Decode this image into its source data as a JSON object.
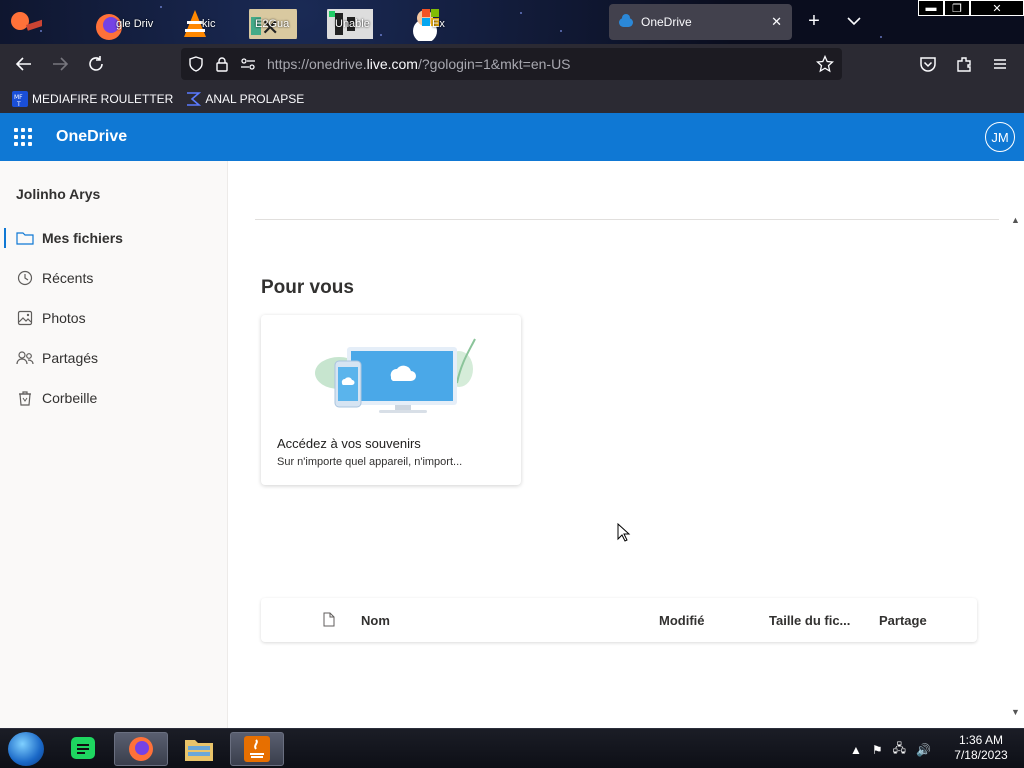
{
  "browser": {
    "desktop_icons": [
      {
        "name": "google-drive",
        "label": "gle Driv"
      },
      {
        "name": "vlc",
        "label": "kic"
      },
      {
        "name": "e2guard",
        "label": "E2Gua"
      },
      {
        "name": "unable",
        "label": "Unable"
      },
      {
        "name": "windows-user",
        "label": "Ex"
      }
    ],
    "active_tab": {
      "title": "OneDrive",
      "close": "✕"
    },
    "new_tab": "+",
    "window_buttons": {
      "min": "▬",
      "max": "❐",
      "close": "✕"
    },
    "url": {
      "prefix": "https://onedrive.",
      "host": "live.com",
      "rest": "/?gologin=1&mkt=en-US"
    },
    "bookmarks": [
      {
        "label": "MEDIAFIRE ROULETTER",
        "icon": "mediafire-icon"
      },
      {
        "label": "ANAL PROLAPSE",
        "icon": "sigma-icon"
      }
    ]
  },
  "onedrive": {
    "app_title": "OneDrive",
    "avatar_initials": "JM",
    "user_name": "Jolinho Arys",
    "nav": [
      {
        "label": "Mes fichiers",
        "icon": "folder-icon",
        "active": true
      },
      {
        "label": "Récents",
        "icon": "clock-icon",
        "active": false
      },
      {
        "label": "Photos",
        "icon": "photo-icon",
        "active": false
      },
      {
        "label": "Partagés",
        "icon": "people-icon",
        "active": false
      },
      {
        "label": "Corbeille",
        "icon": "recycle-bin-icon",
        "active": false
      }
    ],
    "section_title": "Pour vous",
    "card": {
      "title": "Accédez à vos souvenirs",
      "subtitle": "Sur n'importe quel appareil, n'import..."
    },
    "columns": [
      "Nom",
      "Modifié",
      "Taille du fic...",
      "Partage"
    ]
  },
  "taskbar": {
    "apps": [
      "chat-app",
      "firefox",
      "file-explorer",
      "java"
    ],
    "clock_time": "1:36 AM",
    "clock_date": "7/18/2023"
  },
  "colors": {
    "brand": "#0f78d4",
    "browser_chrome": "#2b2a33"
  }
}
